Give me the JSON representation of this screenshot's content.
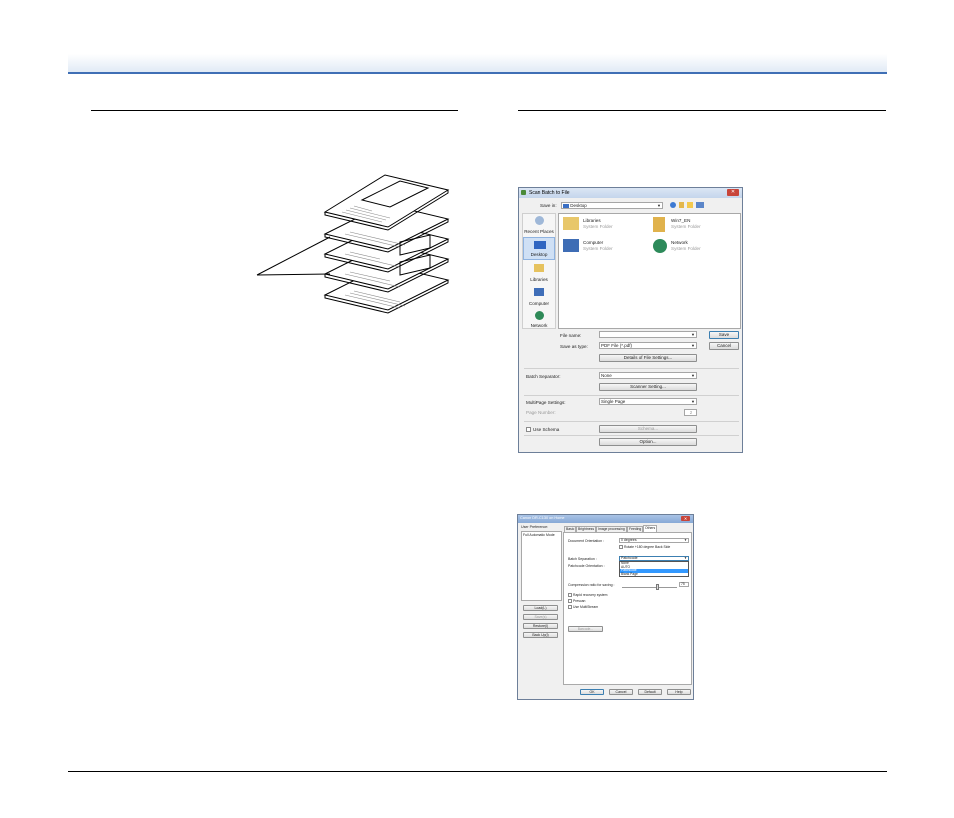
{
  "dialog1": {
    "title": "Scan Batch to File",
    "save_in_label": "Save in:",
    "save_in_value": "Desktop",
    "places": [
      "Recent Places",
      "Desktop",
      "Libraries",
      "Computer",
      "Network"
    ],
    "files": [
      {
        "name": "Libraries",
        "type": "System Folder"
      },
      {
        "name": "Win7_EN",
        "type": "System Folder"
      },
      {
        "name": "Computer",
        "type": "System Folder"
      },
      {
        "name": "Network",
        "type": "System Folder"
      }
    ],
    "file_name_label": "File name:",
    "file_name_value": "",
    "save_as_type_label": "Save as type:",
    "save_as_type_value": "PDF File (*.pdf)",
    "save_button": "Save",
    "cancel_button": "Cancel",
    "details_button": "Details of File Settings...",
    "batch_separator_label": "Batch Separator:",
    "batch_separator_value": "None",
    "scanner_setting_button": "Scanner Setting...",
    "multipage_label": "MultiPage Settings:",
    "multipage_value": "Single Page",
    "page_number_label": "Page Number:",
    "page_number_value": "2",
    "use_schema_label": "Use Schema",
    "schema_button": "Schema...",
    "option_button": "Option..."
  },
  "dialog2": {
    "title": "Canon DR-C130 on Home",
    "user_pref_label": "User Preference:",
    "user_pref_item": "Full Automatic Mode",
    "left_buttons": [
      "Load(L)",
      "Save(s)",
      "Restore(l)",
      "Back Up(l)"
    ],
    "tabs": [
      "Basic",
      "Brightness",
      "Image processing",
      "Feeding",
      "Others"
    ],
    "doc_orientation_label": "Document Orientation :",
    "doc_orientation_value": "0 degrees",
    "rotate_label": "Rotate +180 degree Back Side",
    "batch_separation_label": "Batch Separation :",
    "batch_separation_value": "Patchcode",
    "options": [
      "None",
      "AUTO",
      "Patchcode",
      "Blank Page"
    ],
    "patchcode_orientation_label": "Patchcode Orientation :",
    "compression_label": "Compression ratio for saving :",
    "compression_value": "75",
    "rapid_recovery_label": "Rapid recovery system",
    "prescan_label": "Prescan",
    "multistream_label": "Use MultiStream",
    "barcode_button": "Barcode...",
    "ok": "OK",
    "cancel": "Cancel",
    "default": "Default",
    "help": "Help"
  }
}
